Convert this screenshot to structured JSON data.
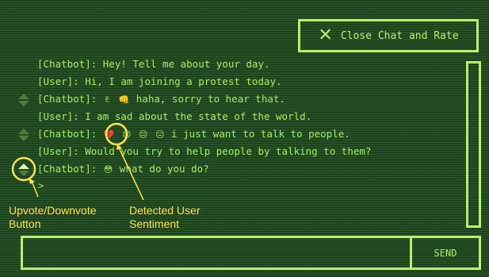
{
  "header": {
    "close_label": "Close Chat and Rate",
    "close_icon": "close-icon"
  },
  "messages": [
    {
      "text": "[Chatbot]: Hey! Tell me about your day."
    },
    {
      "text": "[User]: Hi, I am joining a protest today."
    },
    {
      "prefix": "[Chatbot]: ",
      "emojis": [
        "✌",
        "👊"
      ],
      "suffix": " haha, sorry to hear that."
    },
    {
      "text": "[User]: I am sad about the state of the world."
    },
    {
      "prefix": "[Chatbot]: ",
      "emojis": [
        "💔",
        "😢",
        "😔",
        "😑"
      ],
      "suffix": " i just want to talk to people."
    },
    {
      "text": "[User]: Would you try to help people by talking to them?"
    },
    {
      "prefix": "[Chatbot]: ",
      "emojis": [
        "😳"
      ],
      "suffix": " what do you do?"
    }
  ],
  "prompt": ">",
  "composer": {
    "send_label": "SEND",
    "placeholder": ""
  },
  "annotations": {
    "vote_label": "Upvote/Downvote\nButton",
    "sentiment_label": "Detected User\nSentiment"
  },
  "colors": {
    "background": "#1f4a1f",
    "accent": "#b7f06a",
    "text": "#a8ea63",
    "annotation": "#ffe14d"
  }
}
